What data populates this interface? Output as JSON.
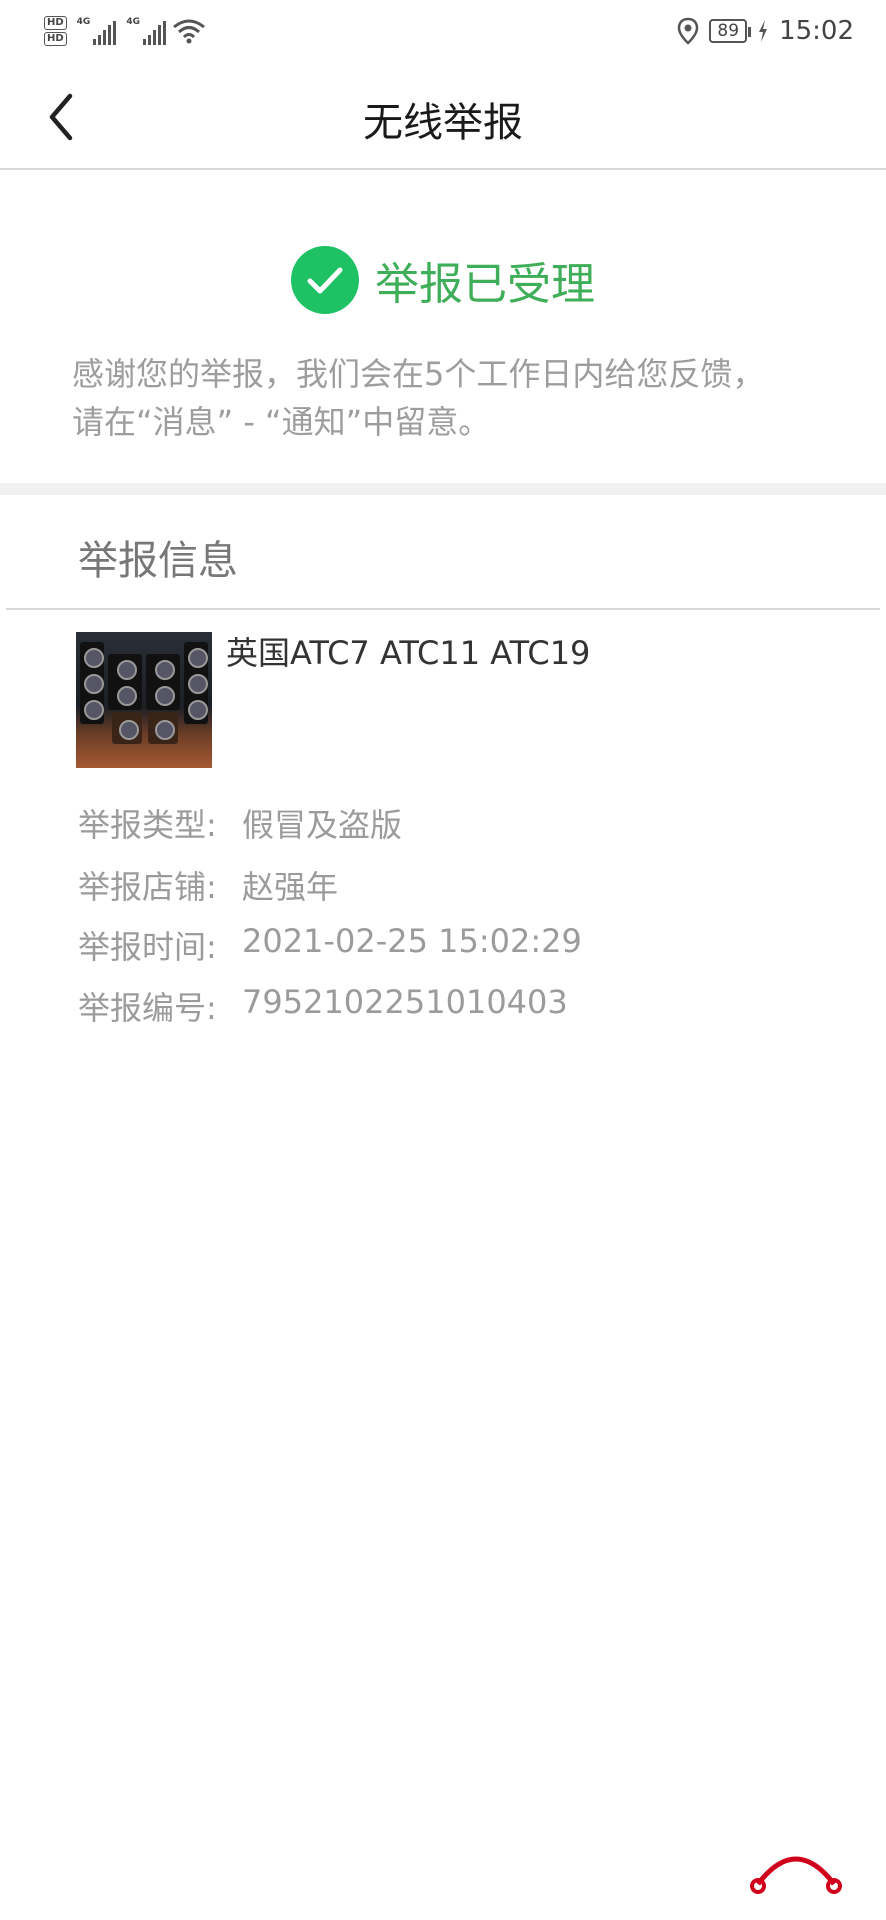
{
  "status_bar": {
    "hd_badges": [
      "HD",
      "HD"
    ],
    "network_tags": [
      "4G",
      "4G"
    ],
    "battery": "89",
    "time": "15:02",
    "icons": [
      "signal-icon",
      "wifi-icon",
      "location-icon",
      "battery-icon",
      "charging-icon"
    ]
  },
  "nav": {
    "title": "无线举报",
    "back_icon": "chevron-left-icon"
  },
  "result": {
    "status_text": "举报已受理",
    "status_icon": "check-circle-icon",
    "notice_line1": "感谢您的举报，我们会在5个工作日内给您反馈，",
    "notice_line2": "请在“消息” - “通知”中留意。"
  },
  "section": {
    "title": "举报信息"
  },
  "product": {
    "title": "英国ATC7 ATC11 ATC19"
  },
  "details": [
    {
      "label": "举报类型:",
      "value": "假冒及盗版"
    },
    {
      "label": "举报店铺:",
      "value": "赵强年"
    },
    {
      "label": "举报时间:",
      "value": "2021-02-25 15:02:29"
    },
    {
      "label": "举报编号:",
      "value": "7952102251010403"
    }
  ],
  "colors": {
    "success_green": "#1fc165",
    "success_text": "#3fae59",
    "logo_red": "#d0021b"
  }
}
